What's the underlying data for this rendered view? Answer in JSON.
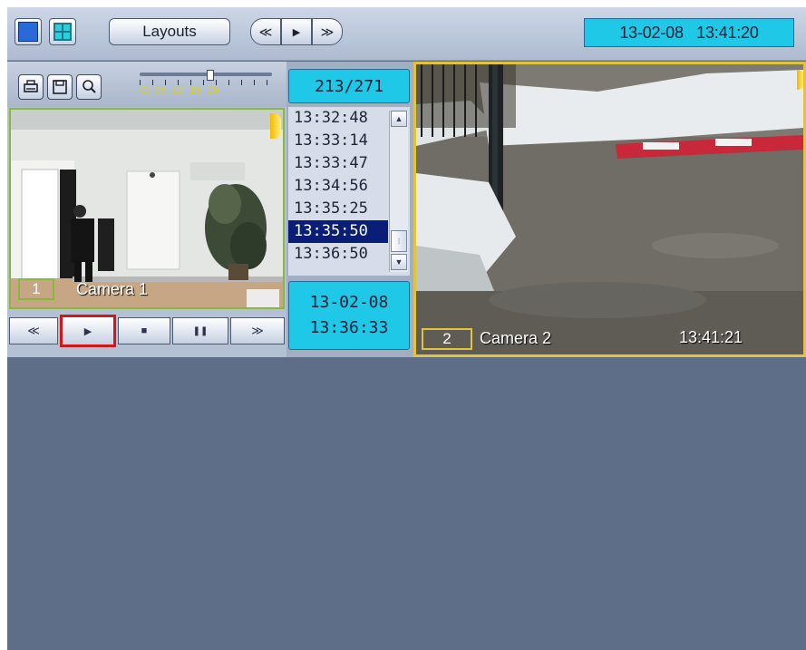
{
  "toolbar": {
    "layouts_label": "Layouts",
    "nav": {
      "rewind_glyph": "≪",
      "play_glyph": "▶",
      "forward_glyph": "≫"
    },
    "datetime": "13-02-08   13:41:20"
  },
  "camera1": {
    "badge": "1",
    "label": "Camera 1",
    "speed_ticks": "00 05  10  15  20",
    "counter": "213/271",
    "times": [
      "13:32:48",
      "13:33:14",
      "13:33:47",
      "13:34:56",
      "13:35:25",
      "13:35:50",
      "13:36:50"
    ],
    "selected_time": "13:35:50",
    "date": "13-02-08",
    "time": "13:36:33",
    "play_glyphs": {
      "prev": "≪",
      "play": "▶",
      "stop": "■",
      "pause": "❚❚",
      "next": "≫"
    }
  },
  "camera2": {
    "badge": "2",
    "label": "Camera 2",
    "timestamp": "13:41:21"
  },
  "colors": {
    "accent_cyan": "#1ec8e6",
    "camera1_border": "#88b83c",
    "camera2_border": "#e2c438",
    "highlight_red": "#d01818",
    "background": "#5e6e88"
  },
  "icons": [
    "single-layout-icon",
    "grid-layout-icon",
    "print-icon",
    "save-icon",
    "zoom-icon",
    "speaker-icon"
  ]
}
